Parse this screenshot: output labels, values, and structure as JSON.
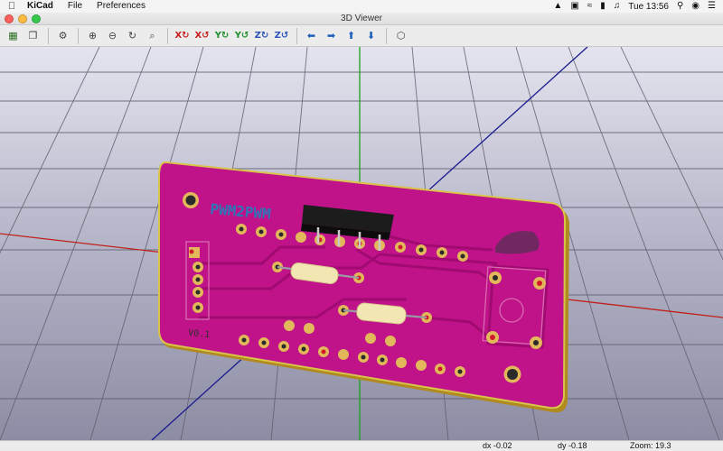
{
  "menubar": {
    "apple_icon": "apple-icon",
    "app_name": "KiCad",
    "menus": [
      "File",
      "Preferences"
    ],
    "clock": "Tue 13:56"
  },
  "window": {
    "title": "3D Viewer"
  },
  "toolbar": {
    "buttons": [
      "render-board-icon",
      "copy-image-icon",
      "settings-gear-icon",
      "zoom-in-icon",
      "zoom-out-icon",
      "redraw-icon",
      "zoom-fit-icon",
      "rotate-x-cw-icon",
      "rotate-x-ccw-icon",
      "rotate-y-cw-icon",
      "rotate-y-ccw-icon",
      "rotate-z-cw-icon",
      "rotate-z-ccw-icon",
      "pan-left-icon",
      "pan-right-icon",
      "pan-up-icon",
      "pan-down-icon",
      "ortho-toggle-icon"
    ]
  },
  "board": {
    "title_text": "PWM2PWM",
    "version_text": "V0.1",
    "colors": {
      "board": "#c0138a",
      "copper": "#e2b85a",
      "edge": "#c4a634"
    }
  },
  "axes": {
    "x_color": "#c0211b",
    "y_color": "#1aa31a",
    "z_color": "#1a1a8f"
  },
  "status": {
    "dx": "dx -0.02",
    "dy": "dy -0.18",
    "zoom": "Zoom: 19.3"
  }
}
